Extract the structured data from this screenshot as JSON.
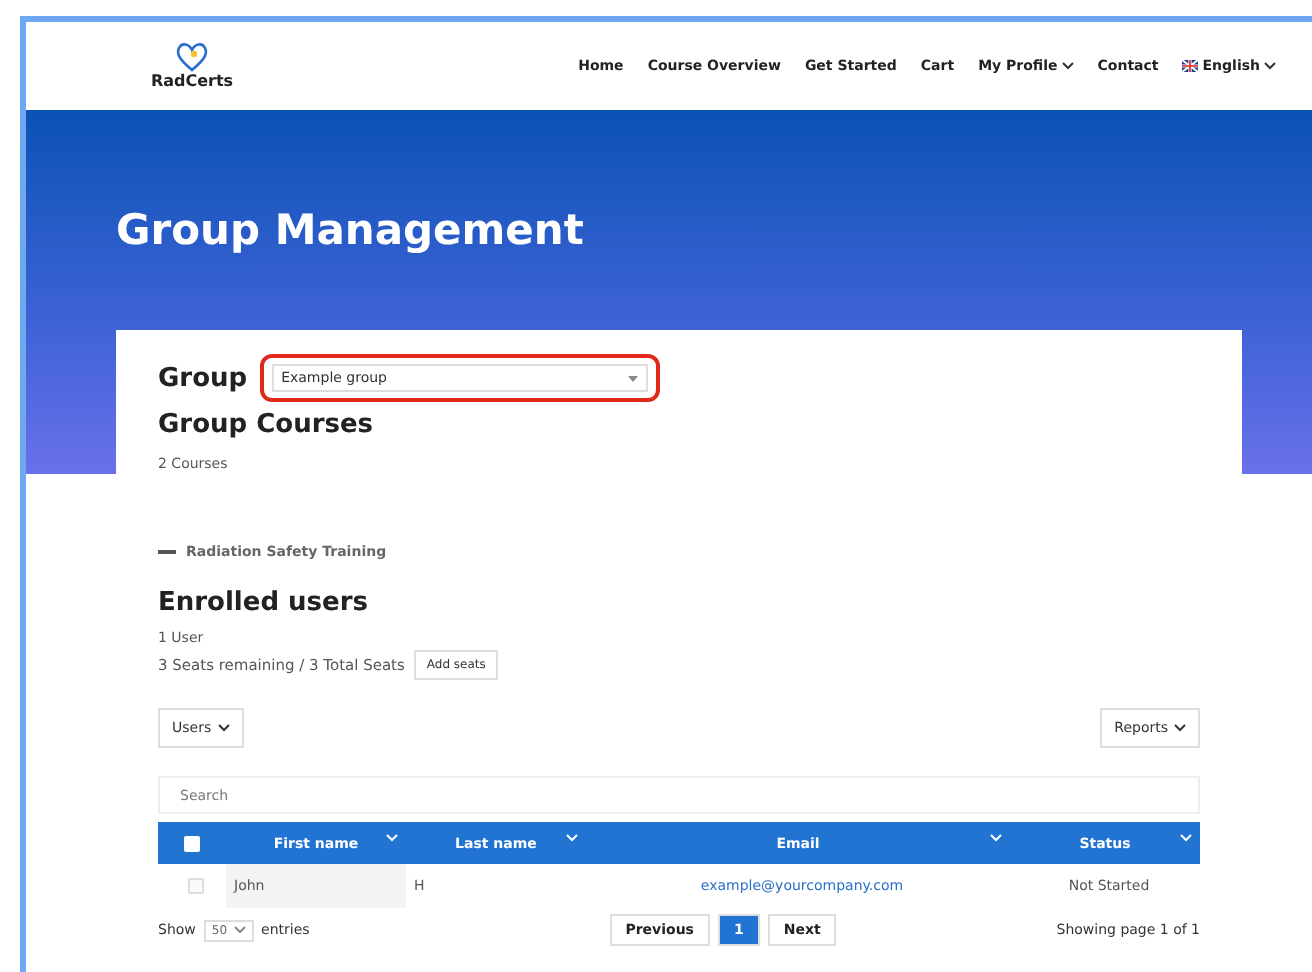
{
  "header": {
    "logo": "RadCerts",
    "nav": [
      {
        "label": "Home",
        "has_menu": false,
        "flag": false
      },
      {
        "label": "Course Overview",
        "has_menu": false,
        "flag": false
      },
      {
        "label": "Get Started",
        "has_menu": false,
        "flag": false
      },
      {
        "label": "Cart",
        "has_menu": false,
        "flag": false
      },
      {
        "label": "My Profile",
        "has_menu": true,
        "flag": false
      },
      {
        "label": "Contact",
        "has_menu": false,
        "flag": false
      },
      {
        "label": "English",
        "has_menu": true,
        "flag": true
      }
    ]
  },
  "hero": {
    "title": "Group Management"
  },
  "group": {
    "label": "Group",
    "value": "Example group"
  },
  "courses": {
    "heading": "Group Courses",
    "count": "2 Courses",
    "items": [
      {
        "label": "Radiation Safety Training"
      }
    ]
  },
  "enrolled": {
    "heading": "Enrolled users",
    "count": "1 User",
    "seats": "3 Seats remaining / 3 Total Seats",
    "add_button": "Add seats"
  },
  "toolbar": {
    "left": "Users",
    "right": "Reports"
  },
  "search": {
    "placeholder": "Search"
  },
  "table": {
    "header_checked": false,
    "columns": [
      "First name",
      "Last name",
      "Email",
      "Status"
    ],
    "rows": [
      {
        "checked": false,
        "cells": [
          "John",
          "H",
          "example@yourcompany.com",
          "Not Started"
        ]
      }
    ]
  },
  "footer": {
    "show": "Show",
    "page_size": "50",
    "entries": "entries",
    "previous": "Previous",
    "pages": [
      {
        "label": "1",
        "selected": true
      }
    ],
    "next": "Next",
    "info": "Showing page 1 of 1"
  }
}
